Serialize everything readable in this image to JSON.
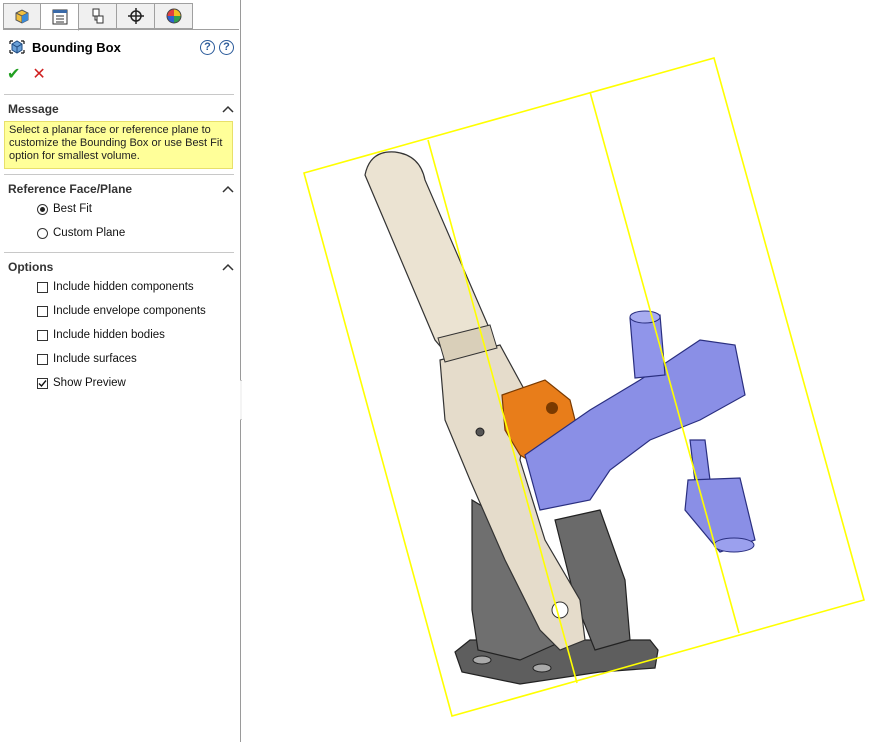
{
  "property_manager": {
    "title": "Bounding Box",
    "tabs": [
      "feature-manager-tab",
      "property-manager-tab",
      "configuration-manager-tab",
      "dimxpert-manager-tab",
      "display-manager-tab"
    ],
    "ok_label": "✔",
    "cancel_label": "✕",
    "help_label": "?",
    "whats_new_label": "?"
  },
  "message_section": {
    "title": "Message",
    "text": "Select a planar face or reference plane to customize the Bounding Box or use Best Fit option for smallest volume."
  },
  "reference_section": {
    "title": "Reference Face/Plane",
    "options": [
      {
        "label": "Best Fit",
        "selected": true
      },
      {
        "label": "Custom Plane",
        "selected": false
      }
    ]
  },
  "options_section": {
    "title": "Options",
    "checkboxes": [
      {
        "label": "Include hidden components",
        "checked": false
      },
      {
        "label": "Include envelope components",
        "checked": false
      },
      {
        "label": "Include hidden bodies",
        "checked": false
      },
      {
        "label": "Include surfaces",
        "checked": false
      },
      {
        "label": "Show Preview",
        "checked": true
      }
    ]
  },
  "colors": {
    "bounding_box": "#ffff00",
    "handle": "#e8dfcc",
    "base": "#6e6e6e",
    "link_orange": "#e87d1a",
    "clamp_blue": "#8a8fe6",
    "message_bg": "#ffff99"
  }
}
